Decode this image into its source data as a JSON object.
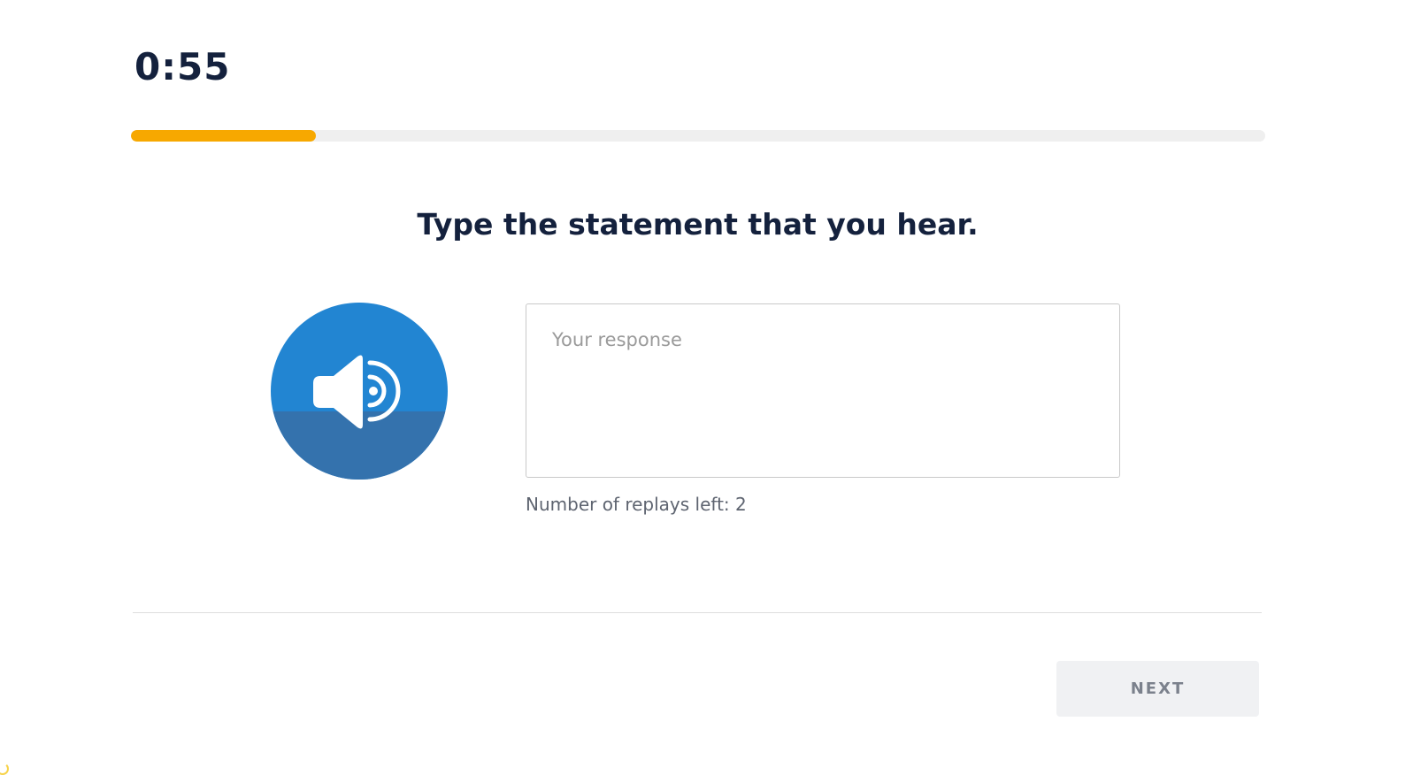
{
  "timer": {
    "value": "0:55"
  },
  "progress": {
    "fraction": 0.163,
    "color": "#f7a800",
    "track_color": "#efefef"
  },
  "prompt": {
    "text": "Type the statement that you hear."
  },
  "audio_button": {
    "icon": "speaker-icon",
    "color": "#2285d2",
    "shade_color": "#3472ad"
  },
  "response": {
    "placeholder": "Your response",
    "value": ""
  },
  "replays": {
    "text": "Number of replays left: 2"
  },
  "footer": {
    "next_label": "NEXT"
  }
}
